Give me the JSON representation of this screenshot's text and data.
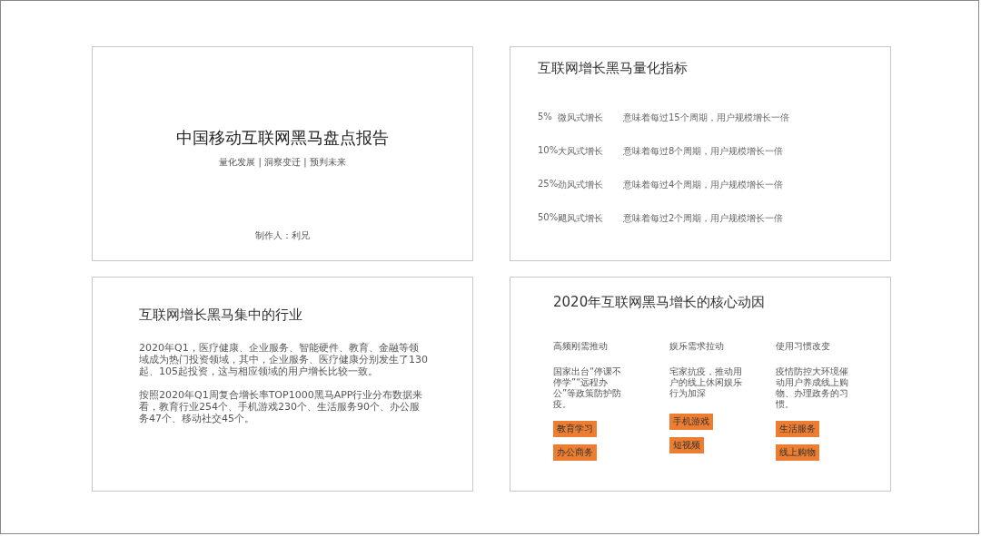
{
  "slides": [
    {
      "kind": "title",
      "title": "中国移动互联网黑马盘点报告",
      "subtitle": "量化发展 | 洞察变迁 | 预判未来",
      "author": "制作人：利兄"
    },
    {
      "kind": "metrics",
      "title": "互联网增长黑马量化指标",
      "rows": [
        {
          "rate": "5%",
          "name": "微风式增长",
          "meaning": "意味着每过15个周期，用户规模增长一倍"
        },
        {
          "rate": "10%",
          "name": "大风式增长",
          "meaning": "意味着每过8个周期，用户规模增长一倍"
        },
        {
          "rate": "25%",
          "name": "劲风式增长",
          "meaning": "意味着每过4个周期，用户规模增长一倍"
        },
        {
          "rate": "50%",
          "name": "飓风式增长",
          "meaning": "意味着每过2个周期，用户规模增长一倍"
        }
      ]
    },
    {
      "kind": "paragraphs",
      "title": "互联网增长黑马集中的行业",
      "paragraphs": [
        "2020年Q1，医疗健康、企业服务、智能硬件、教育、金融等领域成为热门投资领域，其中，企业服务、医疗健康分别发生了130起、105起投资，这与相应领域的用户增长比较一致。",
        "按照2020年Q1周复合增长率TOP1000黑马APP行业分布数据来看，教育行业254个、手机游戏230个、生活服务90个、办公服务47个、移动社交45个。"
      ]
    },
    {
      "kind": "drivers",
      "title": "2020年互联网黑马增长的核心动因",
      "columns": [
        {
          "heading": "高频刚需推动",
          "text": "国家出台“停课不停学”“远程办公”等政策防护防疫。",
          "tags": [
            "教育学习",
            "办公商务"
          ]
        },
        {
          "heading": "娱乐需求拉动",
          "text": "宅家抗疫，推动用户的线上休闲娱乐行为加深",
          "tags": [
            "手机游戏",
            "短视频"
          ]
        },
        {
          "heading": "使用习惯改变",
          "text": "疫情防控大环境催动用户养成线上购物、办理政务的习惯。",
          "tags": [
            "生活服务",
            "线上购物"
          ]
        }
      ]
    }
  ]
}
